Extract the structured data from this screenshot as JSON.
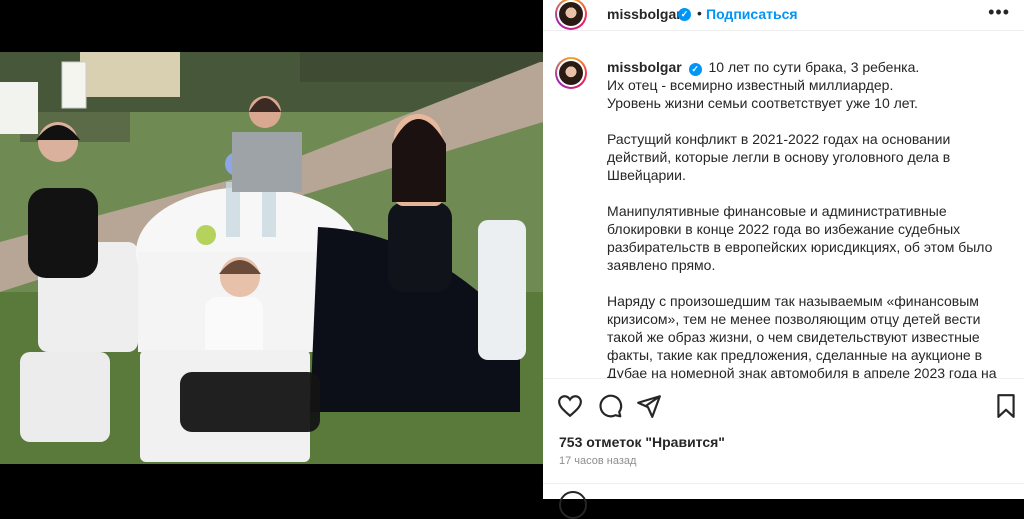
{
  "post": {
    "username": "missbolgar",
    "follow_label": "Подписаться",
    "separator": "•",
    "more_label": "•••",
    "caption": {
      "first_line": "10 лет по сути брака, 3 ребенка.",
      "p1_lines": [
        "Их отец - всемирно известный миллиардер.",
        "Уровень жизни семьи соответствует уже 10 лет."
      ],
      "p2_lines": [
        "Растущий конфликт в 2021-2022 годах на основании",
        "действий, которые легли в основу уголовного дела в",
        "Швейцарии."
      ],
      "p3_lines": [
        "Манипулятивные финансовые и административные",
        "блокировки в конце 2022 года во избежание судебных",
        "разбирательств в европейских юрисдикциях, об этом было",
        "заявлено прямо."
      ],
      "p4_lines": [
        "Наряду с произошедшим так называемым «финансовым",
        "кризисом», тем не менее позволяющим отцу детей вести",
        "такой же образ жизни, о чем свидетельствуют известные",
        "факты, такие как предложения, сделанные на аукционе в",
        "Дубае на номерной знак автомобиля в апреле 2023 года на"
      ]
    },
    "likes": "753 отметок \"Нравится\"",
    "time": "17 часов назад",
    "icons": [
      "heart-icon",
      "comment-icon",
      "share-icon",
      "bookmark-icon",
      "more-icon",
      "verified-badge-icon",
      "emoji-icon"
    ],
    "colors": {
      "accent": "#0095f6",
      "text": "#262626",
      "muted": "#8e8e8e"
    }
  }
}
